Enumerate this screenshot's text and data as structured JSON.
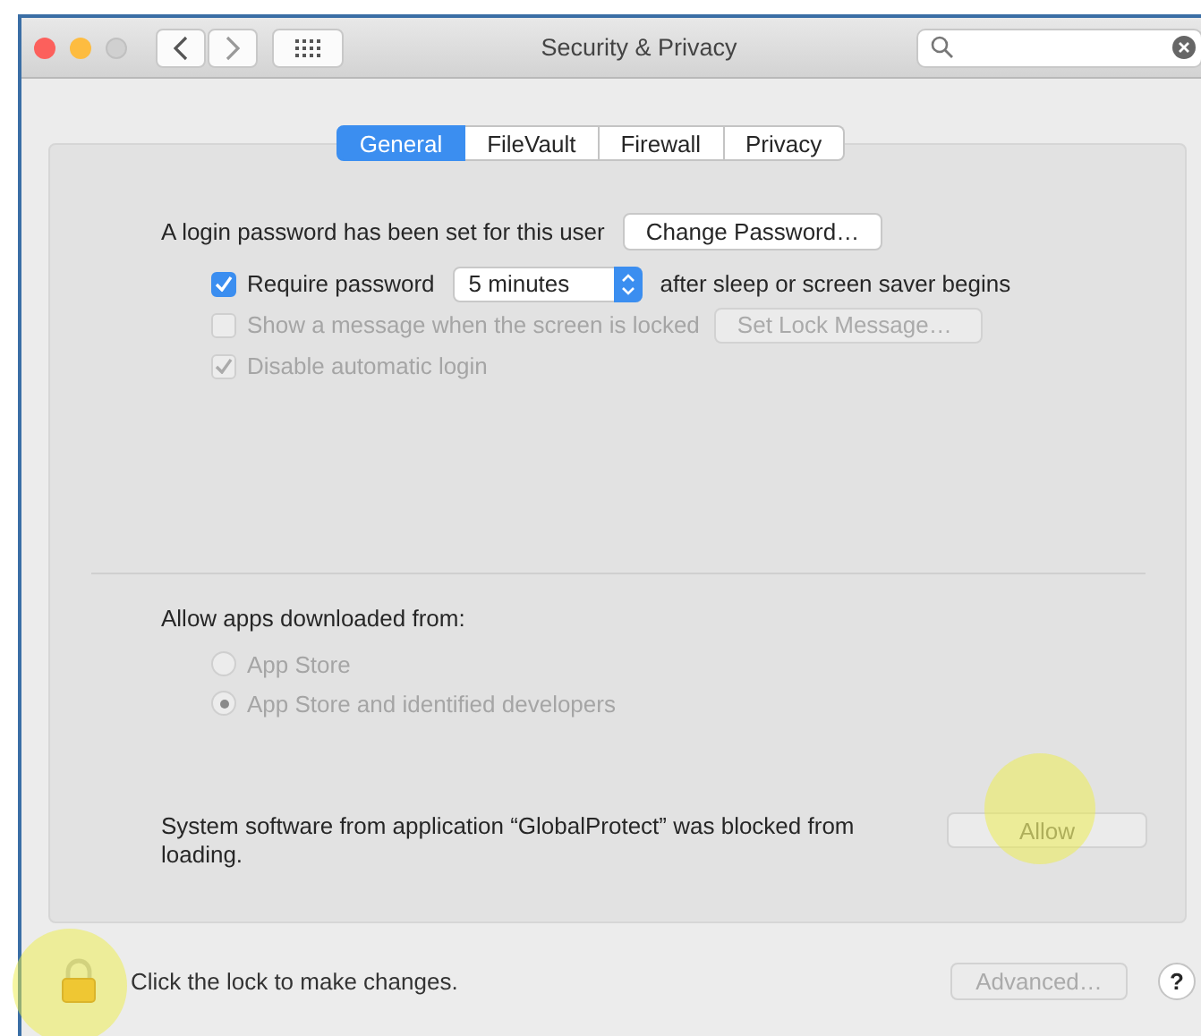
{
  "window": {
    "title": "Security & Privacy"
  },
  "tabs": [
    {
      "label": "General",
      "selected": true
    },
    {
      "label": "FileVault",
      "selected": false
    },
    {
      "label": "Firewall",
      "selected": false
    },
    {
      "label": "Privacy",
      "selected": false
    }
  ],
  "general": {
    "login_text": "A login password has been set for this user",
    "change_password_button": "Change Password…",
    "options": [
      {
        "kind": "require",
        "label": "Require password",
        "checked": true,
        "disabled": false,
        "select": "5 minutes",
        "suffix": "after sleep or screen saver begins"
      },
      {
        "kind": "message",
        "label": "Show a message when the screen is locked",
        "checked": false,
        "disabled": true,
        "button": "Set Lock Message…"
      },
      {
        "kind": "plain",
        "label": "Disable automatic login",
        "checked": true,
        "disabled": true
      }
    ]
  },
  "allow_apps": {
    "heading": "Allow apps downloaded from:",
    "options": [
      {
        "label": "App Store",
        "selected": false,
        "disabled": true
      },
      {
        "label": "App Store and identified developers",
        "selected": true,
        "disabled": true
      }
    ]
  },
  "blocked": {
    "message": "System software from application “GlobalProtect” was blocked from loading.",
    "button": {
      "label": "Allow",
      "disabled": true
    }
  },
  "footer": {
    "lock_text": "Click the lock to make changes.",
    "advanced": {
      "label": "Advanced…",
      "disabled": true
    },
    "help": "?"
  }
}
